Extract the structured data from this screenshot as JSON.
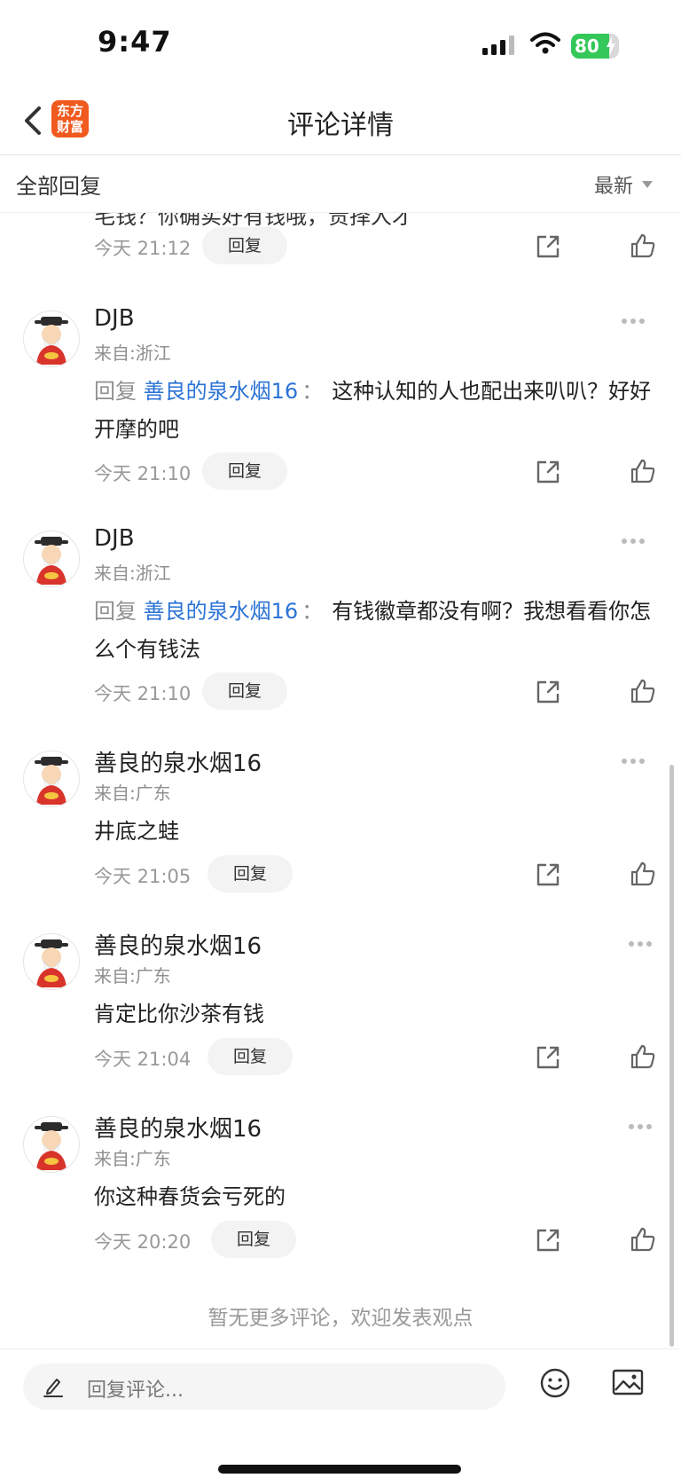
{
  "status_bar": {
    "time": "9:47",
    "battery": "80",
    "battery_level": 0.8
  },
  "header": {
    "back_icon": "chevron-left-icon",
    "app_logo_line1": "东方",
    "app_logo_line2": "财富",
    "title": "评论详情"
  },
  "filter": {
    "label": "全部回复",
    "sort": "最新"
  },
  "clipped_comment": {
    "text": "毛钱？你确实好有钱哦，贵择人才",
    "time": "今天 21:12",
    "reply_label": "回复"
  },
  "comments": [
    {
      "user": "DJB",
      "location": "来自:浙江",
      "reply_prefix": "回复",
      "reply_to": "善良的泉水烟16",
      "colon": "：",
      "text": "这种认知的人也配出来叭叭？好好开摩的吧",
      "time": "今天 21:10",
      "reply_label": "回复"
    },
    {
      "user": "DJB",
      "location": "来自:浙江",
      "reply_prefix": "回复",
      "reply_to": "善良的泉水烟16",
      "colon": "：",
      "text": "有钱徽章都没有啊？我想看看你怎么个有钱法",
      "time": "今天 21:10",
      "reply_label": "回复"
    },
    {
      "user": "善良的泉水烟16",
      "location": "来自:广东",
      "text": "井底之蛙",
      "time": "今天 21:05",
      "reply_label": "回复"
    },
    {
      "user": "善良的泉水烟16",
      "location": "来自:广东",
      "text": "肯定比你沙茶有钱",
      "time": "今天 21:04",
      "reply_label": "回复"
    },
    {
      "user": "善良的泉水烟16",
      "location": "来自:广东",
      "text": "你这种春货会亏死的",
      "time": "今天 20:20",
      "reply_label": "回复"
    }
  ],
  "footer_note": "暂无更多评论，欢迎发表观点",
  "input": {
    "placeholder": "回复评论..."
  },
  "colors": {
    "accent_link": "#2b73d6",
    "logo": "#f05a1e",
    "battery": "#34c759"
  }
}
